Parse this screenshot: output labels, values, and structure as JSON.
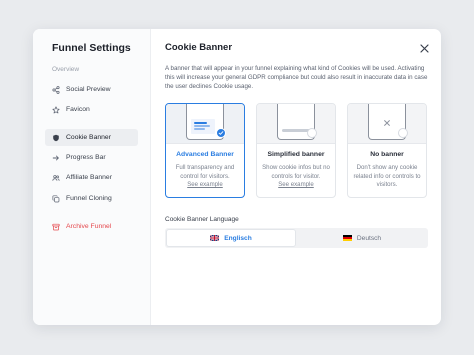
{
  "sidebar": {
    "title": "Funnel Settings",
    "section": "Overview",
    "items": [
      {
        "label": "Social Preview",
        "icon": "share-icon"
      },
      {
        "label": "Favicon",
        "icon": "star-icon"
      },
      {
        "label": "Cookie Banner",
        "icon": "shield-icon",
        "active": true
      },
      {
        "label": "Progress Bar",
        "icon": "arrow-right-icon"
      },
      {
        "label": "Affiliate Banner",
        "icon": "users-icon"
      },
      {
        "label": "Funnel Cloning",
        "icon": "copy-icon"
      },
      {
        "label": "Archive Funnel",
        "icon": "archive-icon",
        "danger": true
      }
    ]
  },
  "main": {
    "title": "Cookie Banner",
    "description": "A banner that will appear in your funnel explaining what kind of Cookies will be used. Activating this will increase your general GDPR compliance but could also result in inaccurate data in case the user declines Cookie usage.",
    "cards": [
      {
        "title": "Advanced Banner",
        "desc": "Full transparency and control for visitors.",
        "link": "See example",
        "selected": true
      },
      {
        "title": "Simplified banner",
        "desc": "Show cookie infos but no controls for visitor.",
        "link": "See example",
        "selected": false
      },
      {
        "title": "No banner",
        "desc": "Don't show any cookie related info or controls to visitors.",
        "link": "",
        "selected": false
      }
    ],
    "language_label": "Cookie Banner Language",
    "languages": [
      {
        "label": "Englisch",
        "flag": "uk-flag-icon",
        "active": true
      },
      {
        "label": "Deutsch",
        "flag": "de-flag-icon",
        "active": false
      }
    ]
  },
  "colors": {
    "accent": "#2a7de1",
    "danger": "#e5484d"
  }
}
